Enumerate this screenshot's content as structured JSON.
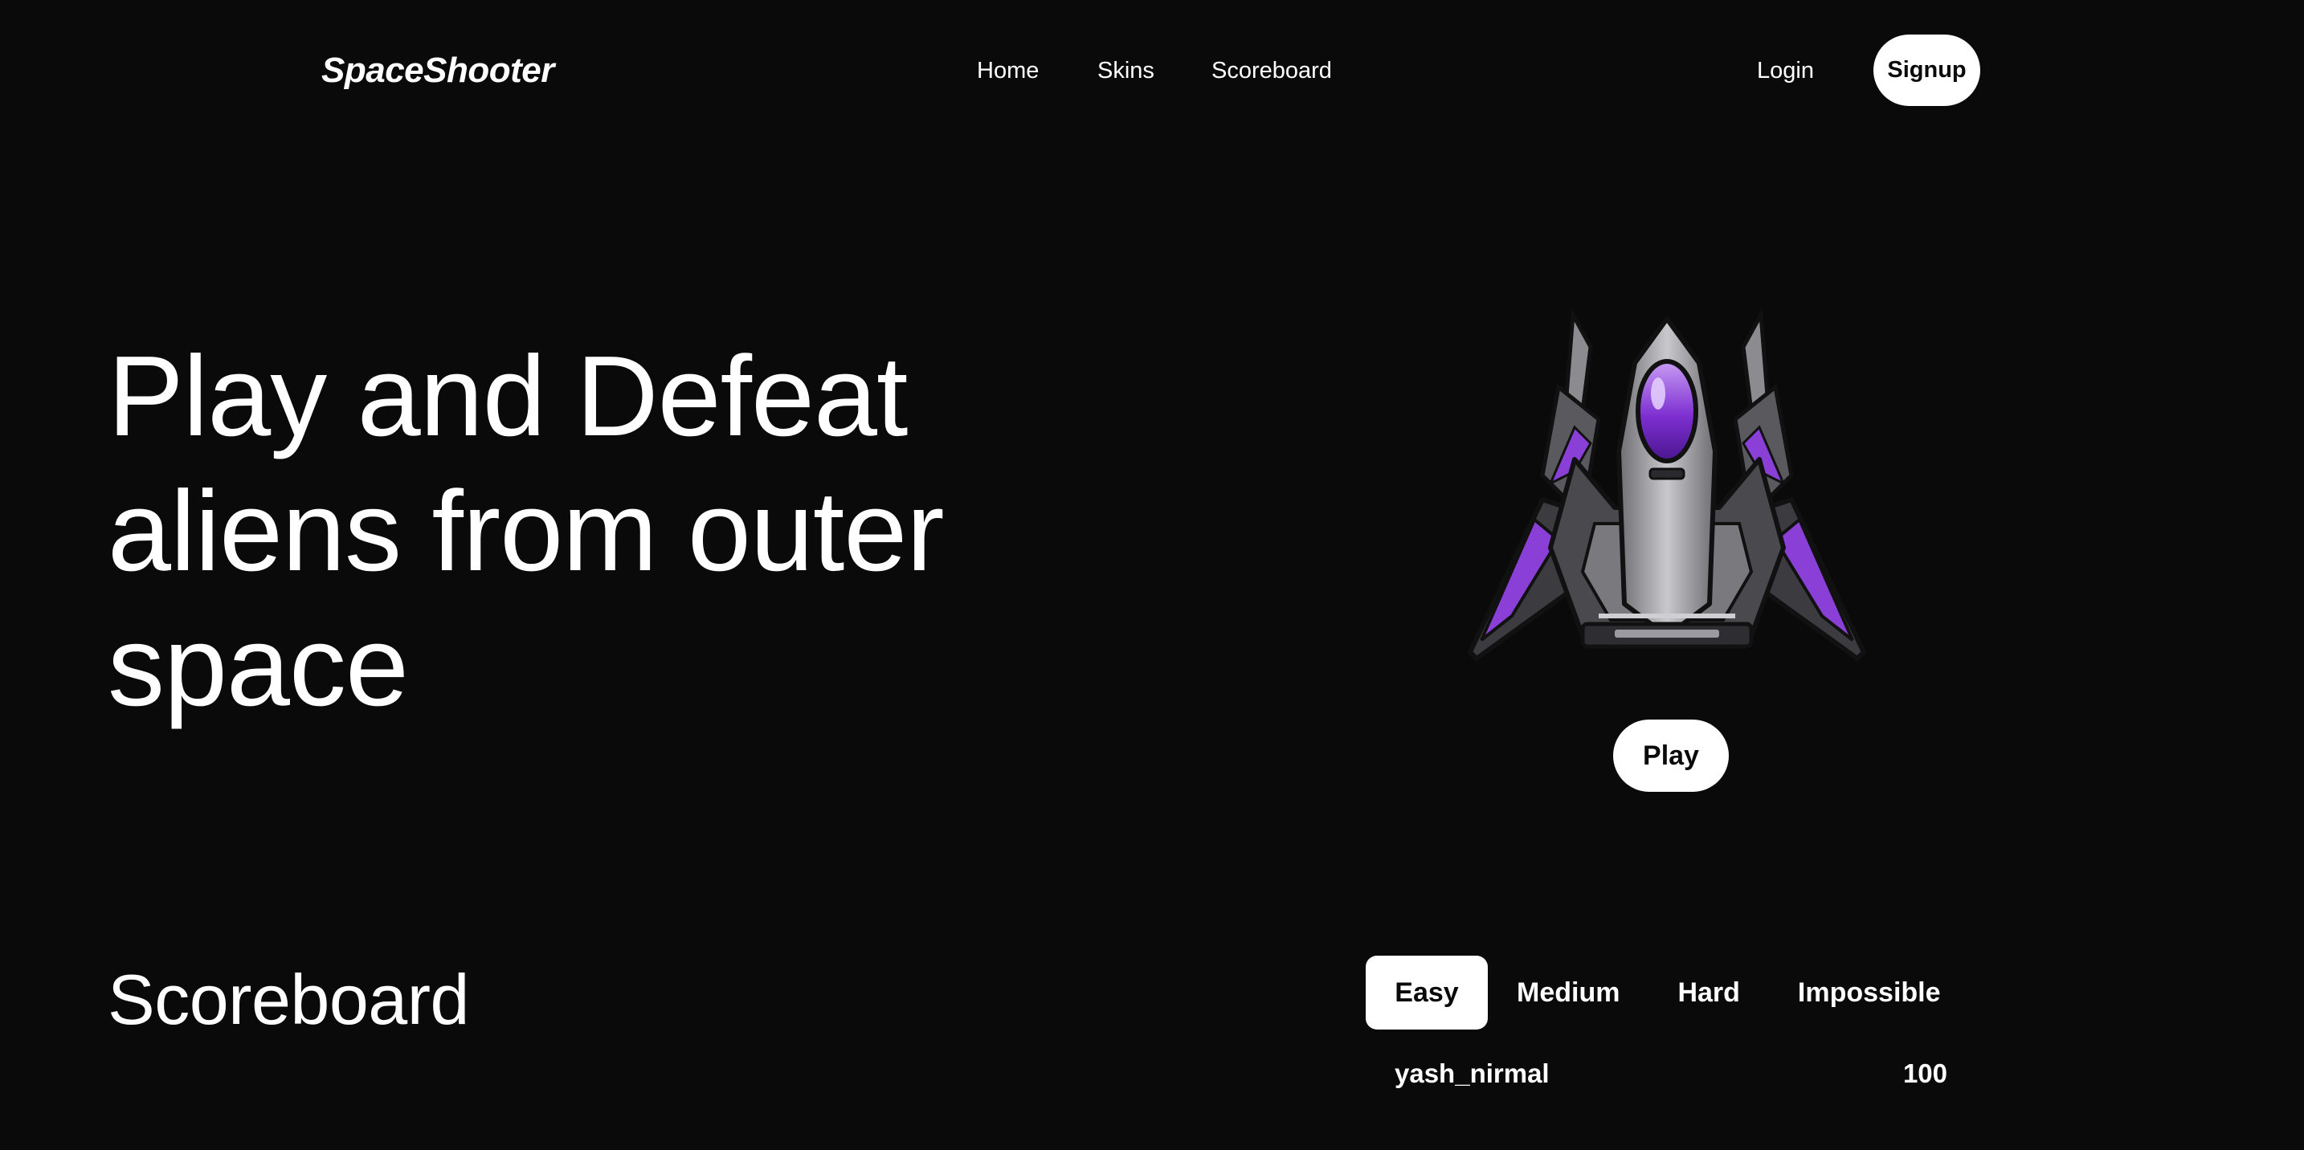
{
  "header": {
    "logo": "SpaceShooter",
    "nav": {
      "home": "Home",
      "skins": "Skins",
      "scoreboard": "Scoreboard"
    },
    "login": "Login",
    "signup": "Signup"
  },
  "hero": {
    "lines": [
      "Play and Defeat",
      "aliens from outer",
      "space"
    ],
    "play_button": "Play",
    "image_icon": "spaceship-icon"
  },
  "scoreboard": {
    "title": "Scoreboard",
    "tabs": [
      "Easy",
      "Medium",
      "Hard",
      "Impossible"
    ],
    "active_tab": "Easy",
    "rows": [
      {
        "player": "yash_nirmal",
        "score": "100"
      }
    ]
  },
  "colors": {
    "background": "#0a0a0a",
    "text": "#ffffff",
    "button_bg": "#ffffff",
    "button_text": "#0a0a0a",
    "ship_accent": "#8a3fd6"
  }
}
